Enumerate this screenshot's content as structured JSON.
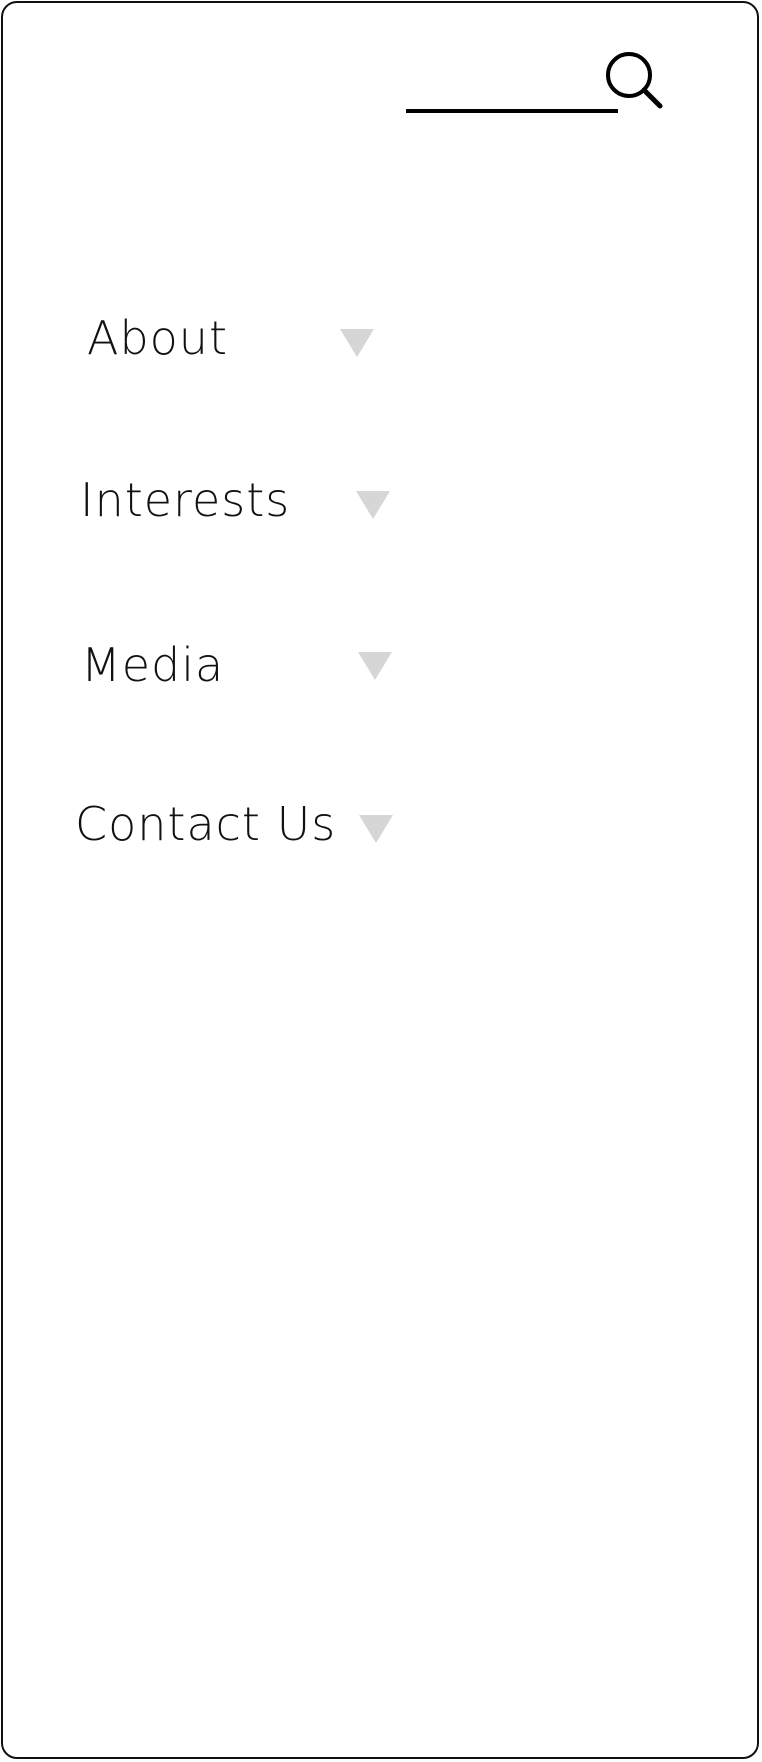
{
  "search": {
    "value": "",
    "placeholder": "",
    "icon": "search-icon"
  },
  "menu": {
    "items": [
      {
        "label": "About",
        "icon": "caret-down-icon"
      },
      {
        "label": "Interests",
        "icon": "caret-down-icon"
      },
      {
        "label": "Media",
        "icon": "caret-down-icon"
      },
      {
        "label": "Contact Us",
        "icon": "caret-down-icon"
      }
    ]
  },
  "colors": {
    "frame_border": "#111111",
    "text": "#111111",
    "caret": "#d6d6d6",
    "background": "#ffffff"
  }
}
